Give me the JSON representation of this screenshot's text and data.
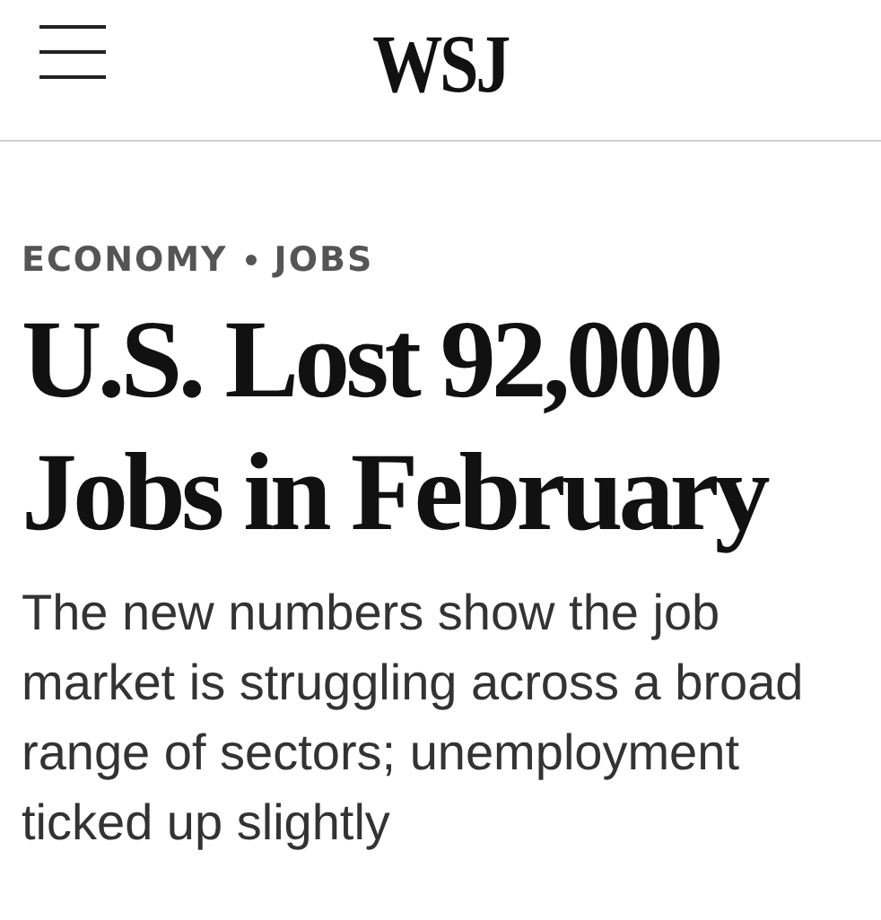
{
  "header": {
    "logo": "WSJ"
  },
  "article": {
    "sections": [
      "ECONOMY",
      "JOBS"
    ],
    "headline": "U.S. Lost 92,000 Jobs in February",
    "dek": "The new numbers show the job market is struggling across a broad range of sectors; unemployment ticked up slightly"
  }
}
